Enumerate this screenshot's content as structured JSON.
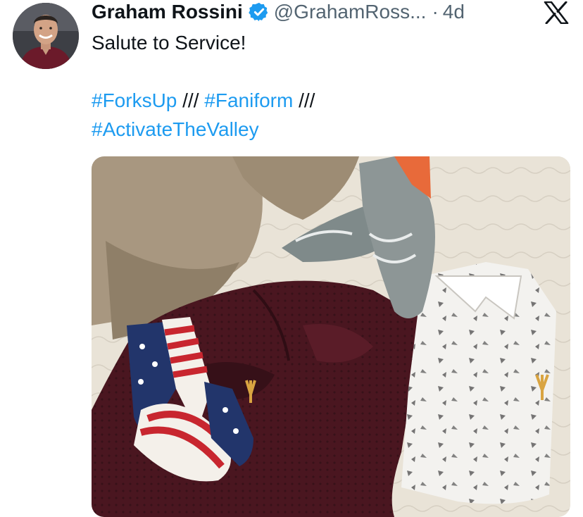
{
  "tweet": {
    "display_name": "Graham Rossini",
    "handle": "@GrahamRoss...",
    "separator": "·",
    "time_ago": "4d",
    "text_line1": "Salute to Service!",
    "hashtags": [
      "#ForksUp",
      "#Faniform",
      "#ActivateTheValley"
    ],
    "separator_text": "///"
  },
  "icons": {
    "verified": "verified-badge-icon",
    "brand": "x-logo-icon"
  },
  "colors": {
    "link": "#1d9bf0",
    "verified": "#1d9bf0",
    "text": "#0f1419",
    "muted": "#536471"
  }
}
